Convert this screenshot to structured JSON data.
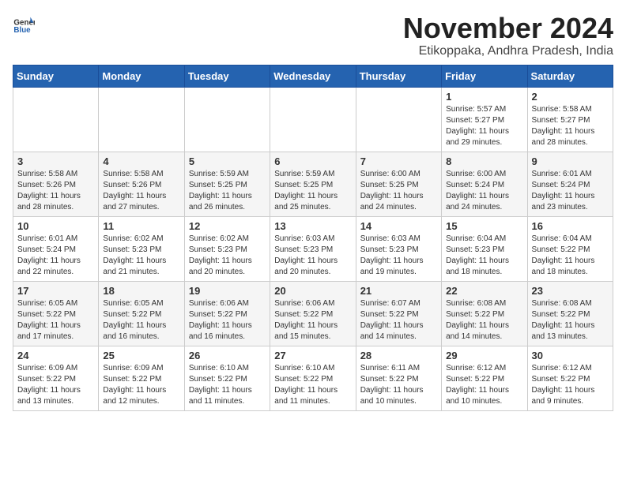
{
  "header": {
    "logo_general": "General",
    "logo_blue": "Blue",
    "month_title": "November 2024",
    "location": "Etikoppaka, Andhra Pradesh, India"
  },
  "weekdays": [
    "Sunday",
    "Monday",
    "Tuesday",
    "Wednesday",
    "Thursday",
    "Friday",
    "Saturday"
  ],
  "weeks": [
    [
      {
        "day": "",
        "info": ""
      },
      {
        "day": "",
        "info": ""
      },
      {
        "day": "",
        "info": ""
      },
      {
        "day": "",
        "info": ""
      },
      {
        "day": "",
        "info": ""
      },
      {
        "day": "1",
        "info": "Sunrise: 5:57 AM\nSunset: 5:27 PM\nDaylight: 11 hours and 29 minutes."
      },
      {
        "day": "2",
        "info": "Sunrise: 5:58 AM\nSunset: 5:27 PM\nDaylight: 11 hours and 28 minutes."
      }
    ],
    [
      {
        "day": "3",
        "info": "Sunrise: 5:58 AM\nSunset: 5:26 PM\nDaylight: 11 hours and 28 minutes."
      },
      {
        "day": "4",
        "info": "Sunrise: 5:58 AM\nSunset: 5:26 PM\nDaylight: 11 hours and 27 minutes."
      },
      {
        "day": "5",
        "info": "Sunrise: 5:59 AM\nSunset: 5:25 PM\nDaylight: 11 hours and 26 minutes."
      },
      {
        "day": "6",
        "info": "Sunrise: 5:59 AM\nSunset: 5:25 PM\nDaylight: 11 hours and 25 minutes."
      },
      {
        "day": "7",
        "info": "Sunrise: 6:00 AM\nSunset: 5:25 PM\nDaylight: 11 hours and 24 minutes."
      },
      {
        "day": "8",
        "info": "Sunrise: 6:00 AM\nSunset: 5:24 PM\nDaylight: 11 hours and 24 minutes."
      },
      {
        "day": "9",
        "info": "Sunrise: 6:01 AM\nSunset: 5:24 PM\nDaylight: 11 hours and 23 minutes."
      }
    ],
    [
      {
        "day": "10",
        "info": "Sunrise: 6:01 AM\nSunset: 5:24 PM\nDaylight: 11 hours and 22 minutes."
      },
      {
        "day": "11",
        "info": "Sunrise: 6:02 AM\nSunset: 5:23 PM\nDaylight: 11 hours and 21 minutes."
      },
      {
        "day": "12",
        "info": "Sunrise: 6:02 AM\nSunset: 5:23 PM\nDaylight: 11 hours and 20 minutes."
      },
      {
        "day": "13",
        "info": "Sunrise: 6:03 AM\nSunset: 5:23 PM\nDaylight: 11 hours and 20 minutes."
      },
      {
        "day": "14",
        "info": "Sunrise: 6:03 AM\nSunset: 5:23 PM\nDaylight: 11 hours and 19 minutes."
      },
      {
        "day": "15",
        "info": "Sunrise: 6:04 AM\nSunset: 5:23 PM\nDaylight: 11 hours and 18 minutes."
      },
      {
        "day": "16",
        "info": "Sunrise: 6:04 AM\nSunset: 5:22 PM\nDaylight: 11 hours and 18 minutes."
      }
    ],
    [
      {
        "day": "17",
        "info": "Sunrise: 6:05 AM\nSunset: 5:22 PM\nDaylight: 11 hours and 17 minutes."
      },
      {
        "day": "18",
        "info": "Sunrise: 6:05 AM\nSunset: 5:22 PM\nDaylight: 11 hours and 16 minutes."
      },
      {
        "day": "19",
        "info": "Sunrise: 6:06 AM\nSunset: 5:22 PM\nDaylight: 11 hours and 16 minutes."
      },
      {
        "day": "20",
        "info": "Sunrise: 6:06 AM\nSunset: 5:22 PM\nDaylight: 11 hours and 15 minutes."
      },
      {
        "day": "21",
        "info": "Sunrise: 6:07 AM\nSunset: 5:22 PM\nDaylight: 11 hours and 14 minutes."
      },
      {
        "day": "22",
        "info": "Sunrise: 6:08 AM\nSunset: 5:22 PM\nDaylight: 11 hours and 14 minutes."
      },
      {
        "day": "23",
        "info": "Sunrise: 6:08 AM\nSunset: 5:22 PM\nDaylight: 11 hours and 13 minutes."
      }
    ],
    [
      {
        "day": "24",
        "info": "Sunrise: 6:09 AM\nSunset: 5:22 PM\nDaylight: 11 hours and 13 minutes."
      },
      {
        "day": "25",
        "info": "Sunrise: 6:09 AM\nSunset: 5:22 PM\nDaylight: 11 hours and 12 minutes."
      },
      {
        "day": "26",
        "info": "Sunrise: 6:10 AM\nSunset: 5:22 PM\nDaylight: 11 hours and 11 minutes."
      },
      {
        "day": "27",
        "info": "Sunrise: 6:10 AM\nSunset: 5:22 PM\nDaylight: 11 hours and 11 minutes."
      },
      {
        "day": "28",
        "info": "Sunrise: 6:11 AM\nSunset: 5:22 PM\nDaylight: 11 hours and 10 minutes."
      },
      {
        "day": "29",
        "info": "Sunrise: 6:12 AM\nSunset: 5:22 PM\nDaylight: 11 hours and 10 minutes."
      },
      {
        "day": "30",
        "info": "Sunrise: 6:12 AM\nSunset: 5:22 PM\nDaylight: 11 hours and 9 minutes."
      }
    ]
  ]
}
